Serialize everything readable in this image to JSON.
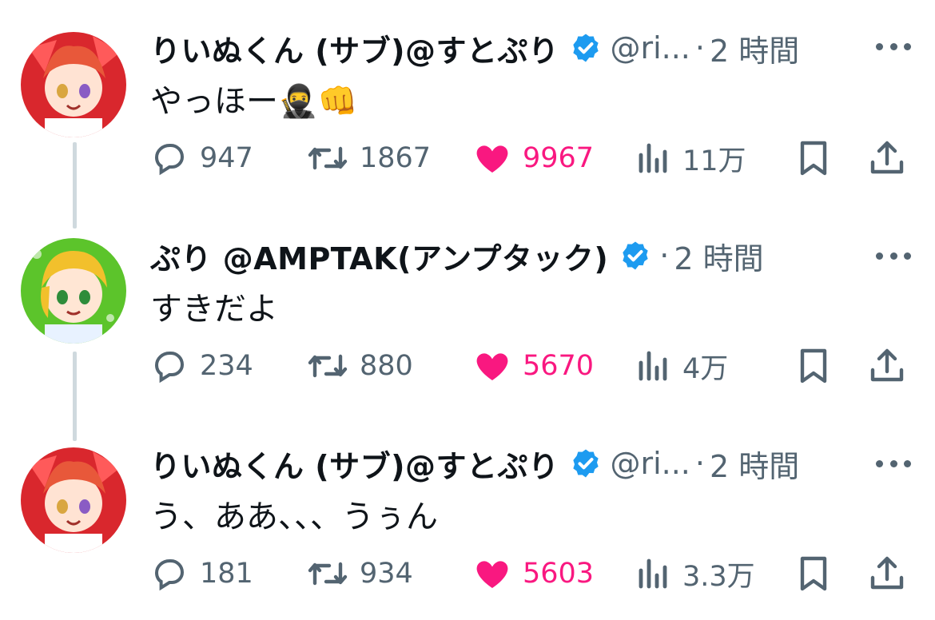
{
  "tweets": [
    {
      "name": "りいぬくん (サブ)@すとぷり",
      "handle": "@ri...",
      "dot": "·",
      "time": "2 時間",
      "text": "やっほー🥷👊",
      "replies": "947",
      "retweets": "1867",
      "likes": "9967",
      "views": "11万",
      "avatar_color": "#d9272d"
    },
    {
      "name": "ぷり @AMPTAK(アンプタック)",
      "handle": "",
      "dot": "·",
      "time": "2 時間",
      "text": "すきだよ",
      "replies": "234",
      "retweets": "880",
      "likes": "5670",
      "views": "4万",
      "avatar_color": "#5cc42b"
    },
    {
      "name": "りいぬくん (サブ)@すとぷり",
      "handle": "@ri...",
      "dot": "·",
      "time": "2 時間",
      "text": "う、ああ、、、うぅん",
      "replies": "181",
      "retweets": "934",
      "likes": "5603",
      "views": "3.3万",
      "avatar_color": "#d9272d"
    }
  ],
  "icons": {
    "reply": "reply-icon",
    "retweet": "retweet-icon",
    "like": "heart-icon",
    "views": "views-icon",
    "bookmark": "bookmark-icon",
    "share": "share-icon",
    "verified": "verified-badge-icon",
    "more": "more-icon"
  },
  "colors": {
    "like": "#f91880",
    "verified": "#1d9bf0",
    "muted": "#536471",
    "thread_line": "#cfd9de"
  }
}
